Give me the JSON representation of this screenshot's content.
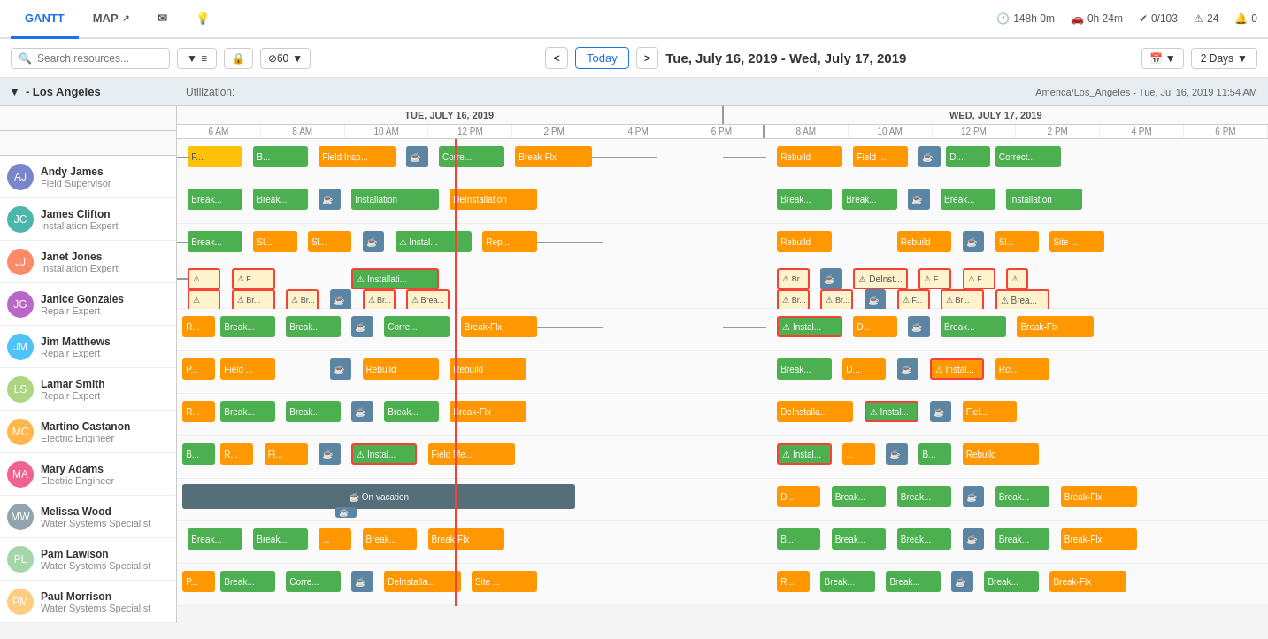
{
  "nav": {
    "tabs": [
      {
        "id": "gantt",
        "label": "GANTT",
        "active": true
      },
      {
        "id": "map",
        "label": "MAP",
        "active": false
      },
      {
        "id": "email",
        "label": "",
        "icon": "envelope"
      },
      {
        "id": "bulb",
        "label": "",
        "icon": "lightbulb"
      }
    ],
    "stats": [
      {
        "icon": "clock",
        "value": "148h 0m"
      },
      {
        "icon": "car",
        "value": "0h 24m"
      },
      {
        "icon": "check",
        "value": "0/103"
      },
      {
        "icon": "warning",
        "value": "24"
      },
      {
        "icon": "bell",
        "value": "0"
      }
    ]
  },
  "toolbar": {
    "search_placeholder": "Search resources...",
    "date_range": "Tue, July 16, 2019 - Wed, July 17, 2019",
    "today_label": "Today",
    "view_label": "2 Days",
    "zoom_label": "⊘60"
  },
  "group": {
    "label": "- Los Angeles",
    "util_label": "Utilization:",
    "tz_label": "America/Los_Angeles - Tue, Jul 16, 2019 11:54 AM"
  },
  "days": [
    {
      "label": "TUE, JULY 16, 2019"
    },
    {
      "label": "WED, JULY 17, 2019"
    }
  ],
  "time_slots": [
    "6 AM",
    "8 AM",
    "10 AM",
    "12 PM",
    "2 PM",
    "4 PM",
    "6 PM",
    "8 AM",
    "10 AM",
    "12 PM",
    "2 PM",
    "4 PM",
    "6 PM"
  ],
  "resources": [
    {
      "id": "andy_james",
      "name": "Andy James",
      "role": "Field Supervisor",
      "initials": "AJ",
      "color": "#7986cb"
    },
    {
      "id": "james_clifton",
      "name": "James Clifton",
      "role": "Installation Expert",
      "initials": "JC",
      "color": "#4db6ac"
    },
    {
      "id": "janet_jones",
      "name": "Janet Jones",
      "role": "Installation Expert",
      "initials": "JJ",
      "color": "#ff8a65"
    },
    {
      "id": "janice_gonzales",
      "name": "Janice Gonzales",
      "role": "Repair Expert",
      "initials": "JG",
      "color": "#ba68c8"
    },
    {
      "id": "jim_matthews",
      "name": "Jim Matthews",
      "role": "Repair Expert",
      "initials": "JM",
      "color": "#4fc3f7"
    },
    {
      "id": "lamar_smith",
      "name": "Lamar Smith",
      "role": "Repair Expert",
      "initials": "LS",
      "color": "#aed581"
    },
    {
      "id": "martino_castanon",
      "name": "Martino Castanon",
      "role": "Electric Engineer",
      "initials": "MC",
      "color": "#ffb74d"
    },
    {
      "id": "mary_adams",
      "name": "Mary Adams",
      "role": "Electric Engineer",
      "initials": "MA",
      "color": "#f06292"
    },
    {
      "id": "melissa_wood",
      "name": "Melissa Wood",
      "role": "Water Systems Specialist",
      "initials": "MW",
      "color": "#90a4ae"
    },
    {
      "id": "pam_lawison",
      "name": "Pam Lawison",
      "role": "Water Systems Specialist",
      "initials": "PL",
      "color": "#a5d6a7"
    },
    {
      "id": "paul_morrison",
      "name": "Paul Morrison",
      "role": "Water Systems Specialist",
      "initials": "PM",
      "color": "#ffcc80"
    }
  ],
  "colors": {
    "green": "#5cb85c",
    "orange": "#f0a030",
    "yellow": "#f5e642",
    "blue_grey": "#5c7a90",
    "break": "#607d8b",
    "vacation": "#546e7a",
    "warn_border": "#f44336",
    "current_time": "#f44336"
  }
}
